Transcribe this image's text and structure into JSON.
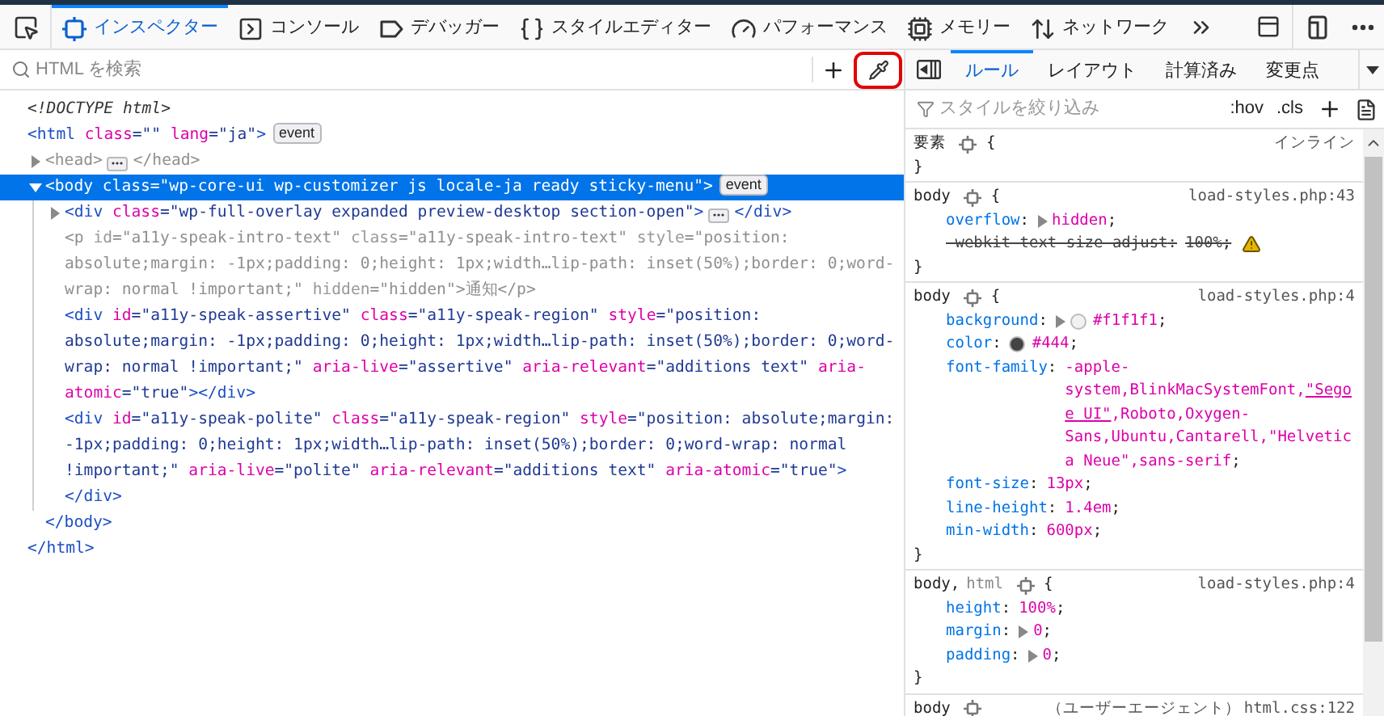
{
  "toolbar": {
    "tabs": [
      {
        "label": "インスペクター",
        "selected": true
      },
      {
        "label": "コンソール",
        "selected": false
      },
      {
        "label": "デバッガー",
        "selected": false
      },
      {
        "label": "スタイルエディター",
        "selected": false
      },
      {
        "label": "パフォーマンス",
        "selected": false
      },
      {
        "label": "メモリー",
        "selected": false
      },
      {
        "label": "ネットワーク",
        "selected": false
      }
    ]
  },
  "markup_search": {
    "placeholder": "HTML を検索",
    "eyedropper_highlighted": true
  },
  "markup": [
    {
      "open": [
        {
          "kind": "doctype",
          "text": "<!DOCTYPE html>"
        }
      ],
      "selected": false,
      "hidden": false
    },
    {
      "open": [
        {
          "kind": "tag",
          "text": "<html"
        },
        {
          "kind": "attr",
          "text": " class"
        },
        {
          "kind": "value",
          "text": "=\"\""
        },
        {
          "kind": "attr",
          "text": " lang"
        },
        {
          "kind": "value",
          "text": "=\"ja\""
        },
        {
          "kind": "tag",
          "text": ">"
        }
      ],
      "badge": "event",
      "selected": false,
      "hidden": false,
      "close": [
        {
          "kind": "tag",
          "text": "</html>"
        }
      ],
      "children": [
        {
          "open": [
            {
              "kind": "tag",
              "text": "<head>"
            }
          ],
          "close": [
            {
              "kind": "tag",
              "text": "</head>"
            }
          ],
          "expanded": false,
          "selected": false,
          "hidden": true
        },
        {
          "open": [
            {
              "kind": "tag",
              "text": "<body"
            },
            {
              "kind": "attr",
              "text": " class"
            },
            {
              "kind": "value",
              "text": "=\"wp-core-ui wp-customizer js locale-ja ready sticky-menu\""
            },
            {
              "kind": "tag",
              "text": ">"
            }
          ],
          "badge": "event",
          "expanded": true,
          "selected": true,
          "hidden": false,
          "close": [
            {
              "kind": "tag",
              "text": "</body>"
            }
          ],
          "children": [
            {
              "open": [
                {
                  "kind": "tag",
                  "text": "<div"
                },
                {
                  "kind": "attr",
                  "text": " class"
                },
                {
                  "kind": "value",
                  "text": "=\"wp-full-overlay expanded preview-desktop section-open\""
                },
                {
                  "kind": "tag",
                  "text": ">"
                }
              ],
              "close": [
                {
                  "kind": "tag",
                  "text": "</div>"
                }
              ],
              "expanded": false,
              "selected": false,
              "hidden": false
            },
            {
              "open": [
                {
                  "kind": "tag",
                  "text": "<p"
                },
                {
                  "kind": "attr",
                  "text": " id"
                },
                {
                  "kind": "value",
                  "text": "=\"a11y-speak-intro-text\""
                },
                {
                  "kind": "attr",
                  "text": " class"
                },
                {
                  "kind": "value",
                  "text": "=\"a11y-speak-intro-text\""
                },
                {
                  "kind": "attr",
                  "text": " style"
                },
                {
                  "kind": "value",
                  "text": "=\"position: absolute;margin: -1px;padding: 0;height: 1px;width…lip-path: inset(50%);border: 0;word-wrap: normal !important;\""
                },
                {
                  "kind": "attr",
                  "text": " hidden"
                },
                {
                  "kind": "value",
                  "text": "=\"hidden\""
                },
                {
                  "kind": "tag",
                  "text": ">"
                },
                {
                  "kind": "text",
                  "text": "通知"
                },
                {
                  "kind": "tag",
                  "text": "</p>"
                }
              ],
              "selected": false,
              "hidden": true
            },
            {
              "open": [
                {
                  "kind": "tag",
                  "text": "<div"
                },
                {
                  "kind": "attr",
                  "text": " id"
                },
                {
                  "kind": "value",
                  "text": "=\"a11y-speak-assertive\""
                },
                {
                  "kind": "attr",
                  "text": " class"
                },
                {
                  "kind": "value",
                  "text": "=\"a11y-speak-region\""
                },
                {
                  "kind": "attr",
                  "text": " style"
                },
                {
                  "kind": "value",
                  "text": "=\"position: absolute;margin: -1px;padding: 0;height: 1px;width…lip-path: inset(50%);border: 0;word-wrap: normal !important;\""
                },
                {
                  "kind": "attr",
                  "text": " aria-live"
                },
                {
                  "kind": "value",
                  "text": "=\"assertive\""
                },
                {
                  "kind": "attr",
                  "text": " aria-relevant"
                },
                {
                  "kind": "value",
                  "text": "=\"additions text\""
                },
                {
                  "kind": "attr",
                  "text": " aria-atomic"
                },
                {
                  "kind": "value",
                  "text": "=\"true\""
                },
                {
                  "kind": "tag",
                  "text": "></div>"
                }
              ],
              "selected": false,
              "hidden": false
            },
            {
              "open": [
                {
                  "kind": "tag",
                  "text": "<div"
                },
                {
                  "kind": "attr",
                  "text": " id"
                },
                {
                  "kind": "value",
                  "text": "=\"a11y-speak-polite\""
                },
                {
                  "kind": "attr",
                  "text": " class"
                },
                {
                  "kind": "value",
                  "text": "=\"a11y-speak-region\""
                },
                {
                  "kind": "attr",
                  "text": " style"
                },
                {
                  "kind": "value",
                  "text": "=\"position: absolute;margin: -1px;padding: 0;height: 1px;width…lip-path: inset(50%);border: 0;word-wrap: normal !important;\""
                },
                {
                  "kind": "attr",
                  "text": " aria-live"
                },
                {
                  "kind": "value",
                  "text": "=\"polite\""
                },
                {
                  "kind": "attr",
                  "text": " aria-relevant"
                },
                {
                  "kind": "value",
                  "text": "=\"additions text\""
                },
                {
                  "kind": "attr",
                  "text": " aria-atomic"
                },
                {
                  "kind": "value",
                  "text": "=\"true\""
                },
                {
                  "kind": "tag",
                  "text": "></div>"
                }
              ],
              "selected": false,
              "hidden": false
            }
          ]
        }
      ]
    }
  ],
  "sidebar": {
    "tabs": [
      {
        "label": "ルール",
        "selected": true
      },
      {
        "label": "レイアウト",
        "selected": false
      },
      {
        "label": "計算済み",
        "selected": false
      },
      {
        "label": "変更点",
        "selected": false
      }
    ],
    "filter": {
      "placeholder": "スタイルを絞り込み"
    },
    "toggles": [
      ":hov",
      ".cls"
    ],
    "rules": [
      {
        "selectors": [
          {
            "text": "要素",
            "matched": true
          }
        ],
        "open": "{",
        "source": "インライン",
        "close": "}"
      },
      {
        "selectors": [
          {
            "text": "body",
            "matched": true
          }
        ],
        "open": "{",
        "source": "load-styles.php:43",
        "close": "}",
        "declarations": [
          {
            "name": "overflow:",
            "value": "hidden;",
            "expandable": true,
            "overridden": false
          },
          {
            "name": "-webkit-text-size-adjust:",
            "value": "100%;",
            "expandable": false,
            "overridden": true
          }
        ]
      },
      {
        "selectors": [
          {
            "text": "body",
            "matched": true
          }
        ],
        "open": "{",
        "source": "load-styles.php:4",
        "close": "}",
        "declarations": [
          {
            "name": "background:",
            "value": "#f1f1f1;",
            "color": "#f1f1f1",
            "expandable": true,
            "overridden": false
          },
          {
            "name": "color:",
            "value": "#444;",
            "color": "#444444",
            "expandable": false,
            "overridden": false
          },
          {
            "name": "font-family:",
            "parts": [
              {
                "text": "-apple-system,BlinkMacSystemFont,",
                "used": false
              },
              {
                "text": "\"Segoe UI\"",
                "used": true
              },
              {
                "text": ",Roboto,Oxygen-Sans,Ubuntu,Cantarell,\"Helvetica Neue\",sans-serif;",
                "used": false
              }
            ],
            "expandable": false,
            "overridden": false
          },
          {
            "name": "font-size:",
            "value": "13px;",
            "expandable": false,
            "overridden": false
          },
          {
            "name": "line-height:",
            "value": "1.4em;",
            "expandable": false,
            "overridden": false
          },
          {
            "name": "min-width:",
            "value": "600px;",
            "expandable": false,
            "overridden": false
          }
        ]
      },
      {
        "selectors": [
          {
            "text": "body,",
            "matched": true
          },
          {
            "text": "html",
            "matched": false
          }
        ],
        "open": "{",
        "source": "load-styles.php:4",
        "close": "}",
        "declarations": [
          {
            "name": "height:",
            "value": "100%;",
            "expandable": false,
            "overridden": false
          },
          {
            "name": "margin:",
            "value": "0;",
            "expandable": true,
            "overridden": false
          },
          {
            "name": "padding:",
            "value": "0;",
            "expandable": true,
            "overridden": false
          }
        ]
      },
      {
        "selectors": [
          {
            "text": "body",
            "matched": true
          }
        ],
        "origin": "（ユーザーエージェント）",
        "source": "html.css:122"
      }
    ]
  }
}
